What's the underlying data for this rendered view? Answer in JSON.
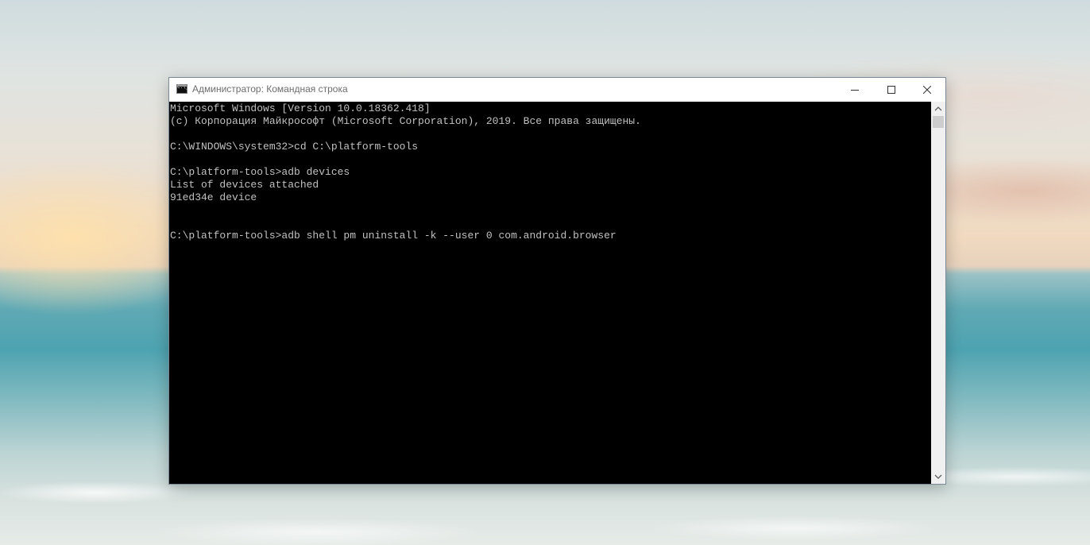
{
  "window": {
    "title": "Администратор: Командная строка",
    "icon": "cmd-icon"
  },
  "controls": {
    "minimize_icon": "minimize-icon",
    "maximize_icon": "maximize-icon",
    "close_icon": "close-icon"
  },
  "console": {
    "lines": [
      "Microsoft Windows [Version 10.0.18362.418]",
      "(c) Корпорация Майкрософт (Microsoft Corporation), 2019. Все права защищены.",
      "",
      "C:\\WINDOWS\\system32>cd C:\\platform-tools",
      "",
      "C:\\platform-tools>adb devices",
      "List of devices attached",
      "91ed34e device",
      "",
      "",
      "C:\\platform-tools>adb shell pm uninstall -k --user 0 com.android.browser"
    ]
  },
  "scrollbar": {
    "up_icon": "chevron-up-icon",
    "down_icon": "chevron-down-icon"
  },
  "colors": {
    "console_bg": "#000000",
    "console_text": "#c0c0c0",
    "title_text": "#6d6d6d"
  }
}
